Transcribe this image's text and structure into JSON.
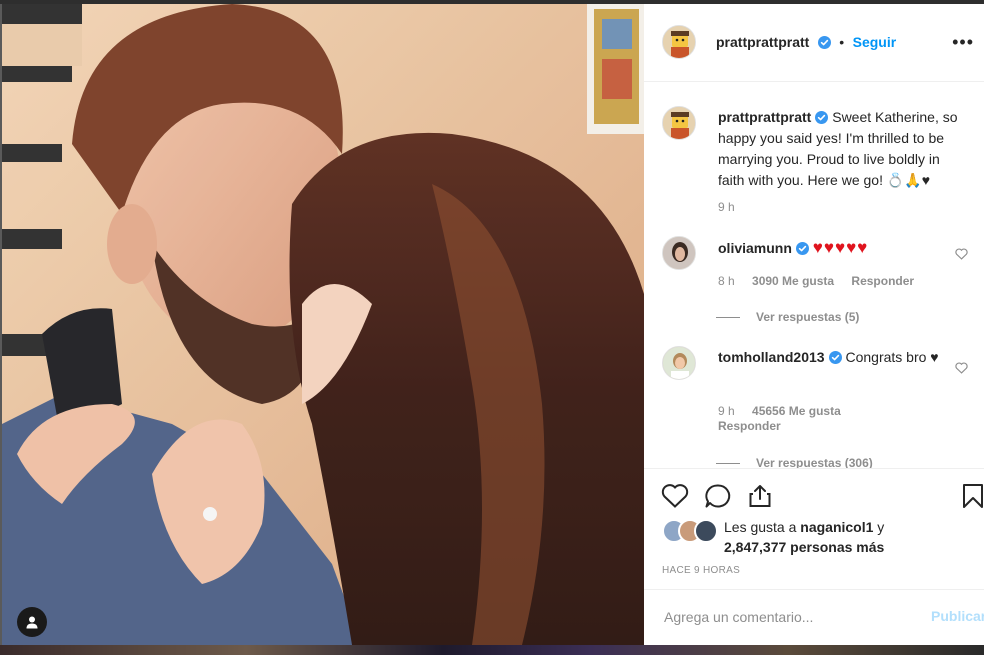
{
  "post": {
    "username": "prattprattpratt",
    "follow_label": "Seguir",
    "more_label": "•••",
    "caption": "Sweet Katherine, so happy you said yes! I'm thrilled to be marrying you. Proud to live boldly in faith with you. Here we go! 💍🙏♥",
    "caption_time": "9 h"
  },
  "comments": [
    {
      "username": "oliviamunn",
      "text": "♥♥♥♥♥",
      "time": "8 h",
      "likes": "3090 Me gusta",
      "reply": "Responder",
      "view_replies": "Ver respuestas (5)"
    },
    {
      "username": "tomholland2013",
      "text": "Congrats bro ♥",
      "time": "9 h",
      "likes": "45656 Me gusta",
      "reply": "Responder",
      "view_replies": "Ver respuestas (306)"
    }
  ],
  "likes": {
    "prefix": "Les gusta a ",
    "user": "naganicol1",
    "suffix": " y",
    "others": "2,847,377 personas más"
  },
  "time_ago": "HACE 9 HORAS",
  "add_comment": {
    "placeholder": "Agrega un comentario...",
    "publish_label": "Publicar"
  },
  "colors": {
    "accent": "#0095f6",
    "heart": "#ed4956"
  }
}
